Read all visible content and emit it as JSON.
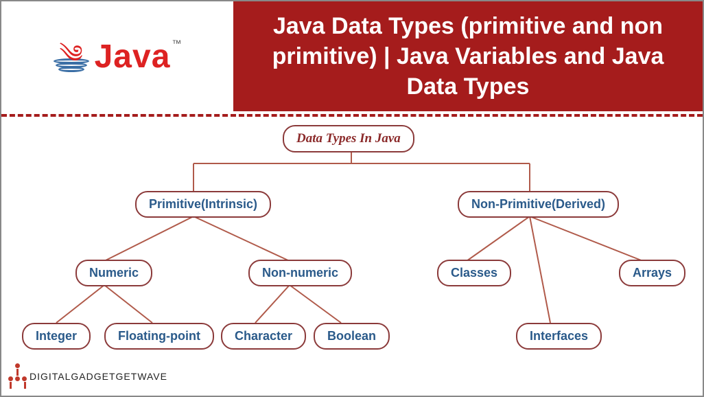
{
  "header": {
    "logo_text": "Java",
    "tm": "™",
    "title": "Java Data Types (primitive and non primitive) | Java Variables and Java Data Types"
  },
  "diagram": {
    "root": "Data Types In Java",
    "primitive": "Primitive(Intrinsic)",
    "nonprimitive": "Non-Primitive(Derived)",
    "numeric": "Numeric",
    "nonnumeric": "Non-numeric",
    "integer": "Integer",
    "floating": "Floating-point",
    "character": "Character",
    "boolean": "Boolean",
    "classes": "Classes",
    "arrays": "Arrays",
    "interfaces": "Interfaces"
  },
  "watermark": "DIGITALGADGETGETWAVE"
}
